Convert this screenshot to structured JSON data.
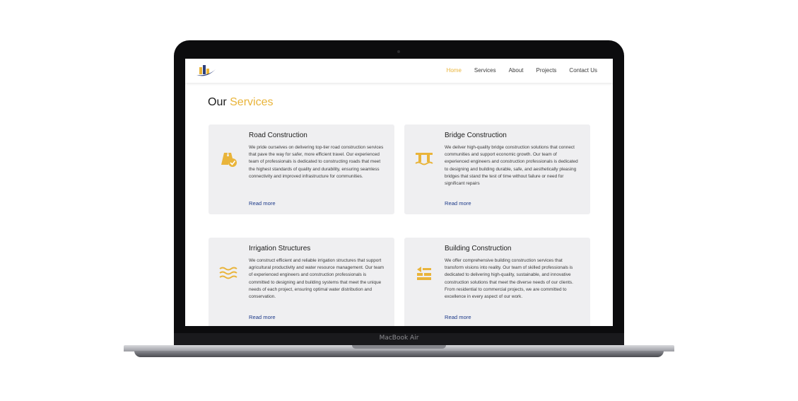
{
  "device": {
    "model_label": "MacBook Air"
  },
  "nav": {
    "links": [
      {
        "label": "Home",
        "active": true
      },
      {
        "label": "Services",
        "active": false
      },
      {
        "label": "About",
        "active": false
      },
      {
        "label": "Projects",
        "active": false
      },
      {
        "label": "Contact Us",
        "active": false
      }
    ]
  },
  "page": {
    "title_prefix": "Our",
    "title_accent": "Services"
  },
  "colors": {
    "accent": "#e9b43a",
    "link": "#1e3b8a",
    "card_bg": "#efeff1"
  },
  "services": [
    {
      "title": "Road Construction",
      "icon": "road-check-icon",
      "description": "We pride ourselves on delivering top-tier road construction services that pave the way for safer, more efficient travel. Our experienced team of professionals is dedicated to constructing roads that meet the highest standards of quality and durability, ensuring seamless connectivity and improved infrastructure for communities.",
      "link": "Read more"
    },
    {
      "title": "Bridge Construction",
      "icon": "bridge-icon",
      "description": "We deliver high-quality bridge construction solutions that connect communities and support economic growth. Our team of experienced engineers and construction professionals is dedicated to designing and building durable, safe, and aesthetically pleasing bridges that stand the test of time without failure or need for significant repairs",
      "link": "Read more"
    },
    {
      "title": "Irrigation Structures",
      "icon": "water-waves-icon",
      "description": "We construct efficient and reliable irrigation structures that support agricultural productivity and water resource management. Our team of experienced engineers and construction professionals is committed to designing and building systems that meet the unique needs of each project, ensuring optimal water distribution and conservation.",
      "link": "Read more"
    },
    {
      "title": "Building Construction",
      "icon": "building-blocks-icon",
      "description": "We offer comprehensive building construction services that transform visions into reality. Our team of skilled professionals is dedicated to delivering high-quality, sustainable, and innovative construction solutions that meet the diverse needs of our clients. From residential to commercial projects, we are committed to excellence in every aspect of our work.",
      "link": "Read more"
    }
  ]
}
